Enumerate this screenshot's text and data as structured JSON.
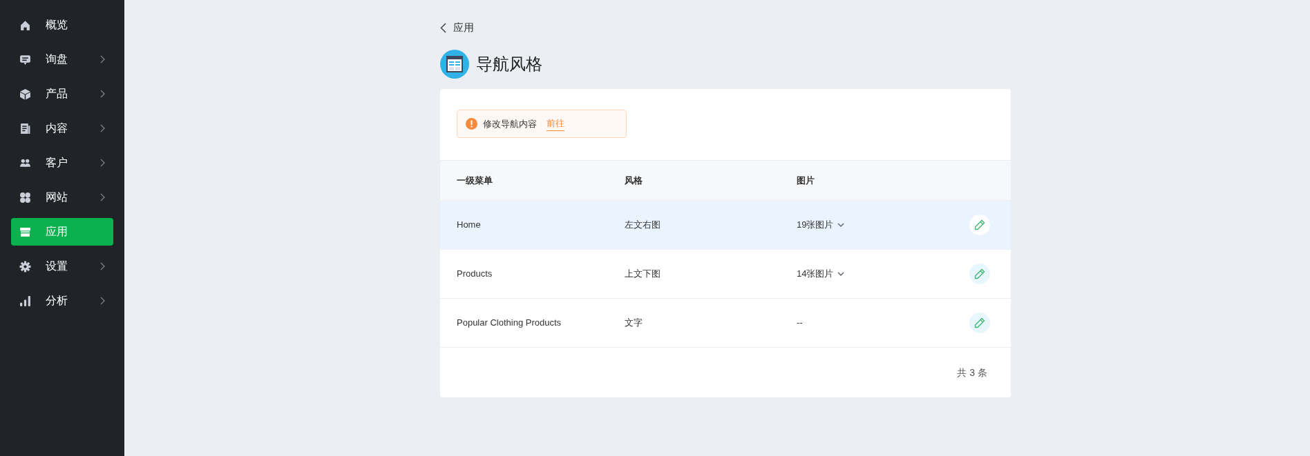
{
  "sidebar": {
    "items": [
      {
        "label": "概览",
        "has_submenu": false,
        "selected": false
      },
      {
        "label": "询盘",
        "has_submenu": true,
        "selected": false
      },
      {
        "label": "产品",
        "has_submenu": true,
        "selected": false
      },
      {
        "label": "内容",
        "has_submenu": true,
        "selected": false
      },
      {
        "label": "客户",
        "has_submenu": true,
        "selected": false
      },
      {
        "label": "网站",
        "has_submenu": true,
        "selected": false
      },
      {
        "label": "应用",
        "has_submenu": false,
        "selected": true
      },
      {
        "label": "设置",
        "has_submenu": true,
        "selected": false
      },
      {
        "label": "分析",
        "has_submenu": true,
        "selected": false
      }
    ]
  },
  "breadcrumb": {
    "back_label": "应用"
  },
  "page_title": "导航风格",
  "alert": {
    "message": "修改导航内容",
    "link": "前往"
  },
  "table": {
    "columns": [
      "一级菜单",
      "风格",
      "图片"
    ],
    "rows": [
      {
        "menu": "Home",
        "style": "左文右图",
        "images": "19张图片",
        "has_dropdown": true,
        "highlighted": true
      },
      {
        "menu": "Products",
        "style": "上文下图",
        "images": "14张图片",
        "has_dropdown": true,
        "highlighted": false
      },
      {
        "menu": "Popular Clothing Products",
        "style": "文字",
        "images": "--",
        "has_dropdown": false,
        "highlighted": false
      }
    ]
  },
  "pagination": {
    "total": "共 3 条"
  }
}
